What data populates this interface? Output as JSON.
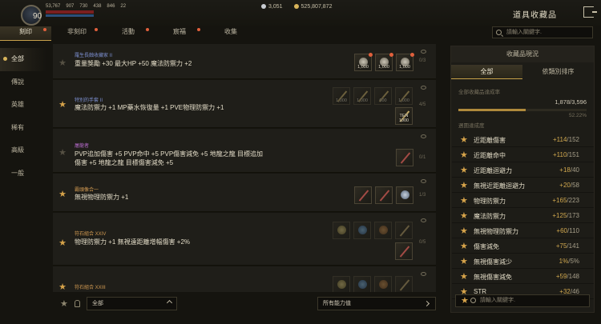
{
  "hud": {
    "level": "90",
    "stats": [
      "53,767",
      "907",
      "730",
      "438",
      "846",
      "22"
    ],
    "silver": "3,051",
    "gold": "525,807,872"
  },
  "window": {
    "title": "道具收藏品"
  },
  "tabs": [
    {
      "label": "刻印",
      "active": true,
      "dot": true
    },
    {
      "label": "非刻印",
      "active": false,
      "dot": true
    },
    {
      "label": "活動",
      "active": false,
      "dot": true
    },
    {
      "label": "宸福",
      "active": false,
      "dot": true
    },
    {
      "label": "收集",
      "active": false,
      "dot": false
    }
  ],
  "search": {
    "placeholder": "請輸入關鍵字."
  },
  "categories": [
    "全部",
    "傳說",
    "英雄",
    "稀有",
    "高級",
    "一般"
  ],
  "rows": [
    {
      "title": "羅生長蝕收藏家 II",
      "title_color": "#7c8fd0",
      "desc": [
        "重量獎勵 +30 最大HP +50 魔法防禦力 +2"
      ],
      "count": "0/3",
      "starred": false
    },
    {
      "title": "特別的手套 II",
      "title_color": "#7c8fd0",
      "desc": [
        "魔法防禦力 +1 MP藥水恢復量 +1 PVE物理防禦力 +1"
      ],
      "count": "4/5",
      "starred": true
    },
    {
      "title": "屠龍者",
      "title_color": "#b46ac9",
      "desc": [
        "PVP追加傷害 +5 PVP命中 +5 PVP傷害減免 +5 地龍之龍 目標追加",
        "傷害 +5 地龍之龍 目標傷害減免 +5"
      ],
      "count": "0/1",
      "starred": false
    },
    {
      "title": "霸頭像合一",
      "title_color": "#d39b52",
      "desc": [
        "無視物理防禦力 +1"
      ],
      "count": "1/3",
      "starred": true
    },
    {
      "title": "符石組合 XXIV",
      "title_color": "#d39b52",
      "desc": [
        "物理防禦力 +1 無視遠距離增幅傷害 +2%"
      ],
      "count": "0/5",
      "starred": true
    },
    {
      "title": "符石組合 XXIII",
      "title_color": "#d39b52",
      "desc": [],
      "count": "",
      "starred": true
    }
  ],
  "row_slot_labels": {
    "r1": [
      "1,000",
      "1,000",
      "1,000"
    ],
    "r2": [
      "1,000",
      "1,000",
      "600",
      "1,000",
      "TEN 1000"
    ]
  },
  "bottom": {
    "filter_value": "全部",
    "sort_value": "所有能力值"
  },
  "panel": {
    "header": "收藏品現況",
    "tab_all": "全部",
    "tab_sort": "依類別排序",
    "overall_label": "全部收藏品達成率",
    "overall_value": "1,878/3,596",
    "overall_fraction": 0.5222,
    "overall_pct": "52.22%",
    "section_label": "週圍達成度",
    "stats": [
      {
        "name": "近距離傷害",
        "value": "+114",
        "max": "152"
      },
      {
        "name": "近距離命中",
        "value": "+110",
        "max": "151"
      },
      {
        "name": "近距離迴避力",
        "value": "+18",
        "max": "40"
      },
      {
        "name": "無視近距離迴避力",
        "value": "+20",
        "max": "58"
      },
      {
        "name": "物理防禦力",
        "value": "+165",
        "max": "223"
      },
      {
        "name": "魔法防禦力",
        "value": "+125",
        "max": "173"
      },
      {
        "name": "無視物理防禦力",
        "value": "+60",
        "max": "110"
      },
      {
        "name": "傷害減免",
        "value": "+75",
        "max": "141"
      },
      {
        "name": "無視傷害減少",
        "value": "1%",
        "max": "5%"
      },
      {
        "name": "無視傷害減免",
        "value": "+59",
        "max": "148"
      },
      {
        "name": "STR",
        "value": "+32",
        "max": "46"
      }
    ],
    "search_placeholder": "請輸入關鍵字."
  },
  "colors": {
    "accent": "#c9a24b",
    "star": "#d6a34a",
    "alert": "#e0603c"
  }
}
